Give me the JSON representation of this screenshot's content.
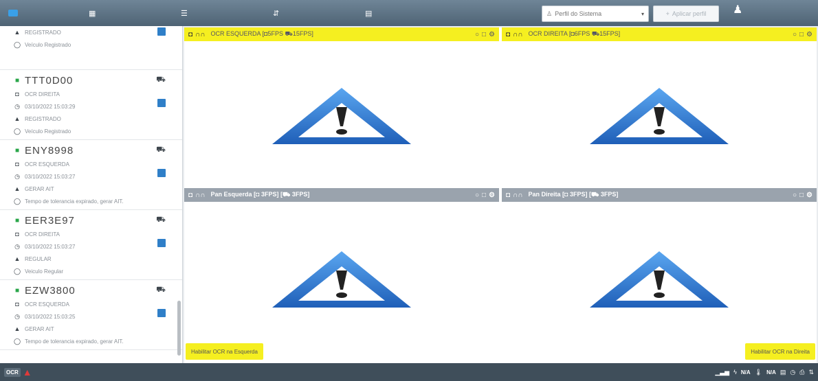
{
  "topbar": {
    "brand": "",
    "nav": [
      {
        "label": "",
        "icon": "grid-icon"
      },
      {
        "label": "",
        "icon": "list-icon"
      },
      {
        "label": "",
        "icon": "chart-icon"
      },
      {
        "label": "",
        "icon": "table-icon"
      }
    ],
    "profile_placeholder": "Perfil do Sistema",
    "apply_label": "Aplicar perfil",
    "user": ""
  },
  "sidebar": {
    "partial": {
      "status": "REGISTRADO",
      "message": "Veículo Registrado"
    },
    "cards": [
      {
        "plate": "TTT0D00",
        "camera": "OCR DIREITA",
        "time": "03/10/2022 15:03:29",
        "status": "REGISTRADO",
        "message": "Veículo Registrado"
      },
      {
        "plate": "ENY8998",
        "camera": "OCR ESQUERDA",
        "time": "03/10/2022 15:03:27",
        "status": "GERAR AIT",
        "message": "Tempo de tolerancia expirado, gerar AIT."
      },
      {
        "plate": "EER3E97",
        "camera": "OCR DIREITA",
        "time": "03/10/2022 15:03:27",
        "status": "REGULAR",
        "message": "Veiculo Regular"
      },
      {
        "plate": "EZW3800",
        "camera": "OCR ESQUERDA",
        "time": "03/10/2022 15:03:25",
        "status": "GERAR AIT",
        "message": "Tempo de tolerancia expirado, gerar AIT."
      }
    ]
  },
  "panels": {
    "ocr_left": "OCR ESQUERDA [",
    "ocr_left_fps": "5FPS",
    "ocr_left_fps2": "15FPS]",
    "ocr_right": "OCR DIREITA [",
    "ocr_right_fps": "6FPS",
    "ocr_right_fps2": "15FPS]",
    "pan_left": "Pan Esquerda",
    "pan_left_fps": "3FPS",
    "pan_left_fps2": "3FPS]",
    "pan_right": "Pan Direita",
    "pan_right_fps": "3FPS",
    "pan_right_fps2": "3FPS]"
  },
  "buttons": {
    "hab_left": "Habilitar OCR na Esquerda",
    "hab_right": "Habilitar OCR na Direita"
  },
  "bottombar": {
    "ocr": "OCR",
    "na1": "N/A",
    "na2": "N/A"
  },
  "colors": {
    "accent_yellow": "#f5ef20",
    "topbar": "#5a6f80",
    "warning_blue": "#2f7fd8"
  }
}
